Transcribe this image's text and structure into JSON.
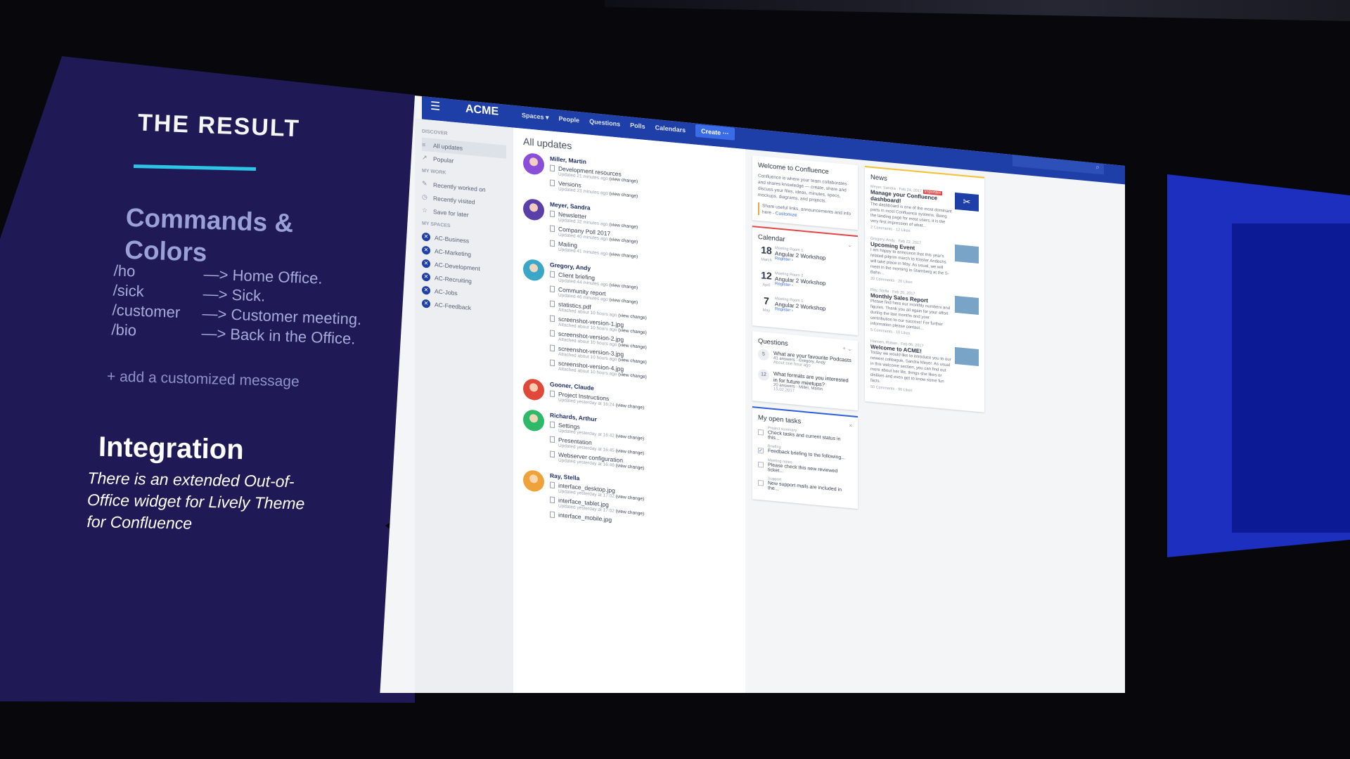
{
  "slide": {
    "title": "THE RESULT",
    "heading": "Commands & Colors",
    "commands": [
      {
        "cmd": "/ho",
        "desc": "—> Home Office."
      },
      {
        "cmd": "/sick",
        "desc": "—> Sick."
      },
      {
        "cmd": "/customer",
        "desc": "—> Customer meeting."
      },
      {
        "cmd": "/bio",
        "desc": "—> Back in the Office."
      }
    ],
    "add_note": "+ add a customized message",
    "integration_title": "Integration",
    "integration_desc": "There is an extended Out-of-Office widget for Lively Theme for Confluence"
  },
  "colors": {
    "accent": "#2ec4e6",
    "slide_bg": "#1f1a55",
    "nav_bg": "#1f3fa8"
  },
  "app": {
    "logo": "ACME",
    "nav": [
      "Spaces ▾",
      "People",
      "Questions",
      "Polls",
      "Calendars"
    ],
    "create_label": "Create ···",
    "search_icon": "⌕"
  },
  "sidebar": {
    "discover_label": "DISCOVER",
    "discover": [
      {
        "icon": "≡",
        "label": "All updates"
      },
      {
        "icon": "↗",
        "label": "Popular"
      }
    ],
    "mywork_label": "MY WORK",
    "mywork": [
      {
        "icon": "✎",
        "label": "Recently worked on"
      },
      {
        "icon": "◷",
        "label": "Recently visited"
      },
      {
        "icon": "☆",
        "label": "Save for later"
      }
    ],
    "spaces_label": "MY SPACES",
    "spaces": [
      "AC-Business",
      "AC-Marketing",
      "AC-Development",
      "AC-Recruiting",
      "AC-Jobs",
      "AC-Feedback"
    ]
  },
  "feed": {
    "title": "All updates",
    "users": [
      {
        "name": "Miller, Martin",
        "color": "#8a4fd8",
        "items": [
          {
            "title": "Development resources",
            "meta": "Updated 21 minutes ago"
          },
          {
            "title": "Versions",
            "meta": "Updated 23 minutes ago"
          }
        ]
      },
      {
        "name": "Meyer, Sandra",
        "color": "#5b3fa8",
        "items": [
          {
            "title": "Newsletter",
            "meta": "Updated 32 minutes ago"
          },
          {
            "title": "Company Poll 2017",
            "meta": "Updated 40 minutes ago"
          },
          {
            "title": "Mailing",
            "meta": "Updated 41 minutes ago"
          }
        ]
      },
      {
        "name": "Gregory, Andy",
        "color": "#3aa6c8",
        "items": [
          {
            "title": "Client briefing",
            "meta": "Updated 44 minutes ago"
          },
          {
            "title": "Community report",
            "meta": "Updated 46 minutes ago"
          },
          {
            "title": "statistics.pdf",
            "meta": "Attached about 10 hours ago"
          },
          {
            "title": "screenshot-version-1.jpg",
            "meta": "Attached about 10 hours ago"
          },
          {
            "title": "screenshot-version-2.jpg",
            "meta": "Attached about 10 hours ago"
          },
          {
            "title": "screenshot-version-3.jpg",
            "meta": "Attached about 10 hours ago"
          },
          {
            "title": "screenshot-version-4.jpg",
            "meta": "Attached about 10 hours ago"
          }
        ]
      },
      {
        "name": "Gooner, Claude",
        "color": "#e0483a",
        "items": [
          {
            "title": "Project Instructions",
            "meta": "Updated yesterday at 16:24"
          }
        ]
      },
      {
        "name": "Richards, Arthur",
        "color": "#2eb86a",
        "items": [
          {
            "title": "Settings",
            "meta": "Updated yesterday at 16:42"
          },
          {
            "title": "Presentation",
            "meta": "Updated yesterday at 16:45"
          },
          {
            "title": "Webserver configuration",
            "meta": "Updated yesterday at 16:46"
          }
        ]
      },
      {
        "name": "Ray, Stella",
        "color": "#f0a23a",
        "items": [
          {
            "title": "interface_desktop.jpg",
            "meta": "Updated yesterday at 17:02"
          },
          {
            "title": "interface_tablet.jpg",
            "meta": "Updated yesterday at 17:02"
          },
          {
            "title": "interface_mobile.jpg",
            "meta": ""
          }
        ]
      }
    ],
    "view_change": "(view change)"
  },
  "welcome": {
    "title": "Welcome to Confluence",
    "text": "Confluence is where your team collaborates and shares knowledge — create, share and discuss your files, ideas, minutes, specs, mockups, diagrams, and projects.",
    "link_text": "Share useful links, announcements and info here -",
    "link_label": "Customize"
  },
  "calendar": {
    "title": "Calendar",
    "events": [
      {
        "day": "18",
        "month": "March",
        "room": "Meeting Room 1",
        "event": "Angular 2 Workshop",
        "register": "Register ›"
      },
      {
        "day": "12",
        "month": "April",
        "room": "Meeting Room 2",
        "event": "Angular 2 Workshop",
        "register": "Register ›"
      },
      {
        "day": "7",
        "month": "May",
        "room": "Meeting Room 1",
        "event": "Angular 2 Workshop",
        "register": "Register ›"
      }
    ]
  },
  "questions": {
    "title": "Questions",
    "items": [
      {
        "count": "5",
        "text": "What are your favourite Podcasts",
        "meta": "41 answers · Gregory, Andy",
        "date": "About one hour ago"
      },
      {
        "count": "12",
        "text": "What formats are you interested in for future meetups?",
        "meta": "20 answers · Miller, Martin",
        "date": "15.02.2017"
      }
    ]
  },
  "tasks": {
    "title": "My open tasks",
    "items": [
      {
        "cat": "Project summary",
        "text": "Check tasks and current status in this...",
        "checked": ""
      },
      {
        "cat": "Briefing",
        "text": "Feedback briefing to the following...",
        "checked": "✓"
      },
      {
        "cat": "Meeting notes",
        "text": "Please check this new reviewed ticket...",
        "checked": ""
      },
      {
        "cat": "Support",
        "text": "New support mails are included in the...",
        "checked": ""
      }
    ]
  },
  "news": {
    "title": "News",
    "items": [
      {
        "by": "Meyer, Sandra · Feb 24, 2017",
        "tag": "Important",
        "head": "Manage your Confluence dashboard!",
        "body": "The dashboard is one of the most dominant parts in most Confluence systems. Being the landing page for most users, it is the very first impression of what...",
        "stats": "2 Comments · 12 Likes",
        "thumb": "logo"
      },
      {
        "by": "Gregory, Andy · Feb 22, 2017",
        "tag": "",
        "head": "Upcoming Event",
        "body": "I am happy to announce that this year's related pilgrim march to Kloster Andechs will take place in May. As usual, we will meet in the morning in Starnberg at the S-Bahn...",
        "stats": "20 Comments · 20 Likes",
        "thumb": "photo"
      },
      {
        "by": "Ray, Stella · Feb 20, 2017",
        "tag": "",
        "head": "Monthly Sales Report",
        "body": "Please find here our monthly numbers and figures. Thank you all again for your effort during the last months and your contribution to our success! For further information please contact...",
        "stats": "5 Comments · 10 Likes",
        "thumb": "photo"
      },
      {
        "by": "Hansen, Ruben · Feb 06, 2017",
        "tag": "",
        "head": "Welcome to ACME!",
        "body": "Today we would like to introduce you to our newest colleague, Sandra Meyer. As usual in this welcome section, you can find out more about her life, things she likes or dislikes and even get to know some fun facts.",
        "stats": "50 Comments · 90 Likes",
        "thumb": "photo"
      }
    ]
  }
}
